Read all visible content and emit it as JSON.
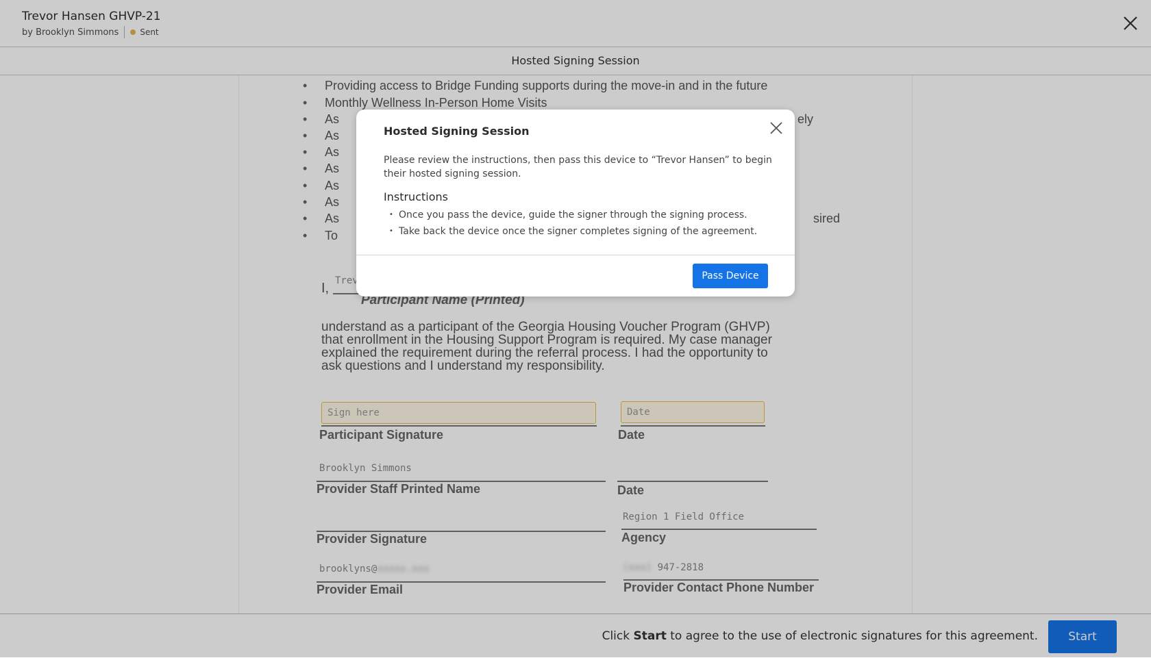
{
  "header": {
    "title": "Trevor Hansen GHVP-21",
    "byline": "by Brooklyn Simmons",
    "status": "Sent",
    "status_color": "#e5b352"
  },
  "subheader": {
    "title": "Hosted Signing Session"
  },
  "document": {
    "bullets": [
      "Providing access to Bridge Funding supports during the move-in and in the future",
      "Monthly Wellness In-Person Home Visits",
      "As",
      "As",
      "As",
      "As",
      "As",
      "As",
      "As",
      "To"
    ],
    "bullet_tail_3": "ely",
    "bullet_tail_9": "sired",
    "participant_prefix": "I,",
    "participant_name_value": "Trev",
    "participant_name_label": "Participant Name (Printed)",
    "paragraph": [
      "understand as a participant of the Georgia Housing Voucher Program (GHVP)",
      "that enrollment in the Housing Support Program is required. My case manager",
      "explained the requirement during the referral process. I had the opportunity to",
      "ask questions and I understand my responsibility."
    ],
    "sign_placeholder": "Sign here",
    "date_placeholder": "Date",
    "participant_signature_label": "Participant Signature",
    "date_label": "Date",
    "provider_name_value": "Brooklyn Simmons",
    "provider_name_label": "Provider Staff Printed Name",
    "provider_date_label": "Date",
    "agency_value": "Region 1 Field Office",
    "agency_label": "Agency",
    "provider_signature_label": "Provider Signature",
    "provider_email_value": "brooklyns@",
    "provider_email_redacted": "xxxxx.xxx",
    "provider_email_label": "Provider Email",
    "phone_redacted": "(xxx)",
    "phone_value": "947-2818",
    "phone_label": "Provider Contact Phone Number"
  },
  "footer": {
    "text_prefix": "Click ",
    "text_bold": "Start",
    "text_suffix": " to agree to the use of electronic signatures for this agreement.",
    "start_label": "Start",
    "accent": "#1473e6"
  },
  "modal": {
    "title": "Hosted Signing Session",
    "body": "Please review the instructions, then pass this device to “Trevor Hansen” to begin their hosted signing session.",
    "instructions_title": "Instructions",
    "instructions": [
      "Once you pass the device, guide the signer through the signing process.",
      "Take back the device once the signer completes signing of the agreement."
    ],
    "button_label": "Pass Device"
  }
}
